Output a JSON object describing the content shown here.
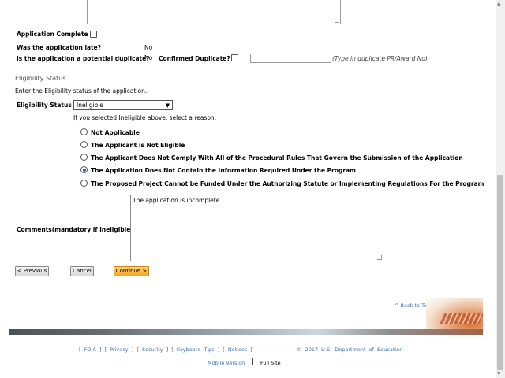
{
  "form": {
    "application_complete_label": "Application Complete",
    "late_label": "Was the application late?",
    "late_value": "No",
    "duplicate_label": "Is the application a potential duplicate?",
    "duplicate_value": "No",
    "confirmed_duplicate_label": "Confirmed Duplicate?",
    "confirmed_duplicate_value": "",
    "duplicate_hint": "(Type in duplicate PR/Award No)"
  },
  "eligibility": {
    "section_title": "Eligibility Status",
    "instruction": "Enter the Eligibility status of the application.",
    "status_label": "Eligibility Status",
    "status_value": "Ineligible",
    "reason_prompt": "If you selected Ineligible above, select a reason:",
    "reasons": [
      {
        "label": "Not Applicable",
        "selected": false
      },
      {
        "label": "The Applicant is Not Eligible",
        "selected": false
      },
      {
        "label": "The Applicant Does Not Comply With All of the Procedural Rules That Govern the Submission of the Application",
        "selected": false
      },
      {
        "label": "The Application Does Not Contain the Information Required Under the Program",
        "selected": true
      },
      {
        "label": "The Proposed Project Cannot be Funded Under the Authorizing Statute or Implementing Regulations For the Program",
        "selected": false
      }
    ],
    "comments_label": "Comments(mandatory if ineligible)",
    "comments_value": "The application is incomplete."
  },
  "buttons": {
    "previous": "< Previous",
    "cancel": "Cancel",
    "continue": "Continue >"
  },
  "back_to_top": "^ Back to Top",
  "footer": {
    "links": [
      "FOIA",
      "Privacy",
      "Security",
      "Keyboard Tips",
      "Notices"
    ],
    "copyright": "© 2017 U.S. Department of Education",
    "mobile_version": "Mobile Version",
    "full_site": "Full Site"
  },
  "colors": {
    "section_title": "#555555",
    "link": "#3a6fb0",
    "continue_button": "#f5a623"
  }
}
